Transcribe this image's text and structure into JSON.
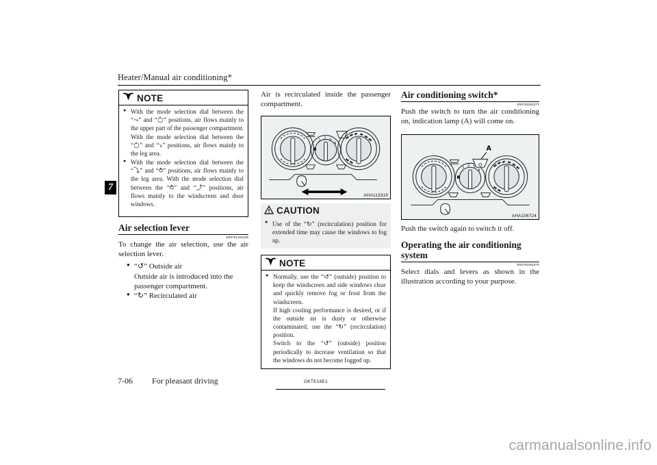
{
  "header": {
    "title": "Heater/Manual air conditioning*"
  },
  "chapter_tab": "7",
  "column_left": {
    "note_box": {
      "label": "NOTE",
      "icon": "book-icon",
      "bullets": [
        "With the mode selection dial between the “⤳” and “⥁” positions, air flows mainly to the upper part of the passenger compartment. With the mode selection dial between the “⥁” and “⤵” positions, air flows mainly to the leg area.",
        "With the mode selection dial between the “⤵” and “⥁” positions, air flows mainly to the leg area. With the mode selection dial between the “⥁” and “⤴” positions, air flows mainly to the windscreen and door windows."
      ]
    },
    "section": {
      "heading": "Air selection lever",
      "refcode": "E00701401035",
      "intro": "To change the air selection, use the air selection lever.",
      "items": [
        {
          "bullet": "“↺” Outside air",
          "detail": "Outside air is introduced into the passenger compartment."
        },
        {
          "bullet": "“↻” Recirculated air",
          "detail": ""
        }
      ]
    }
  },
  "column_middle": {
    "intro": "Air is recirculated inside the passenger compartment.",
    "figure": {
      "code": "AHA113319",
      "name": "hvac-control-panel-lever-illustration"
    },
    "caution_box": {
      "label": "CAUTION",
      "icon": "warning-triangle-icon",
      "bullets": [
        "Use of the “↻” (recirculation) position for extended time may cause the windows to fog up."
      ]
    },
    "note_box": {
      "label": "NOTE",
      "icon": "book-icon",
      "bullets": [
        "Normally, use the “↺” (outside) position to keep the windscreen and side windows clear and quickly remove fog or frost from the windscreen.",
        "If high cooling performance is desired, or if the outside air is dusty or otherwise contaminated, use the “↻” (recirculation) position.",
        "Switch to the “↺” (outside) position periodically to increase ventilation so that the windows do not become fogged up."
      ]
    }
  },
  "column_right": {
    "section_ac_switch": {
      "heading": "Air conditioning switch*",
      "refcode": "E00701502277",
      "body": "Push the switch to turn the air conditioning on, indication lamp (A) will come on."
    },
    "figure": {
      "code": "AHA106724",
      "callout": "A",
      "name": "hvac-control-panel-ac-switch-illustration"
    },
    "after_figure": "Push the switch again to switch it off.",
    "section_operating": {
      "heading": "Operating the air conditioning system",
      "refcode": "E00701801576",
      "body": "Select dials and levers as shown in the illustration according to your purpose."
    }
  },
  "footer": {
    "page_number": "7-06",
    "section_name": "For pleasant driving",
    "doc_code": "OKTE18E1"
  },
  "watermark": "carmanualsonline.info"
}
